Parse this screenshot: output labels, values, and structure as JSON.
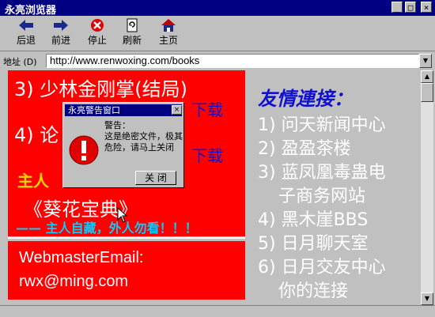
{
  "window": {
    "title": "永亮浏览器"
  },
  "toolbar": {
    "back": "后退",
    "forward": "前进",
    "stop": "停止",
    "refresh": "刷新",
    "home": "主页"
  },
  "address": {
    "label": "地址 (D)",
    "url": "http://www.renwoxing.com/books"
  },
  "content": {
    "line1": "3) 少林金刚掌(结局)",
    "line2": "4) 论",
    "download1": "下载",
    "download2": "下载",
    "owner": "主人",
    "book": "《葵花宝典》",
    "note": "—— 主人自藏，外人勿看！！！",
    "email_label": "WebmasterEmail:",
    "email": "rwx@ming.com",
    "friends_title": "友情連接：",
    "friends": [
      "1) 问天新闻中心",
      "2) 盈盈茶楼",
      "3) 蓝凤凰毒蛊电",
      "子商务网站",
      "4) 黑木崖BBS",
      "5) 日月聊天室",
      "6) 日月交友中心",
      "你的连接"
    ]
  },
  "dialog": {
    "title": "永亮警告窗口",
    "message_head": "警告：",
    "message": "这是绝密文件，极其危险，请马上关闭",
    "button": "关 闭"
  },
  "colors": {
    "titlebar": "#000080",
    "content_red": "#ff0000",
    "link_blue": "#1010d0",
    "owner_yellow": "#ffd700",
    "note_cyan": "#00d0ff"
  }
}
